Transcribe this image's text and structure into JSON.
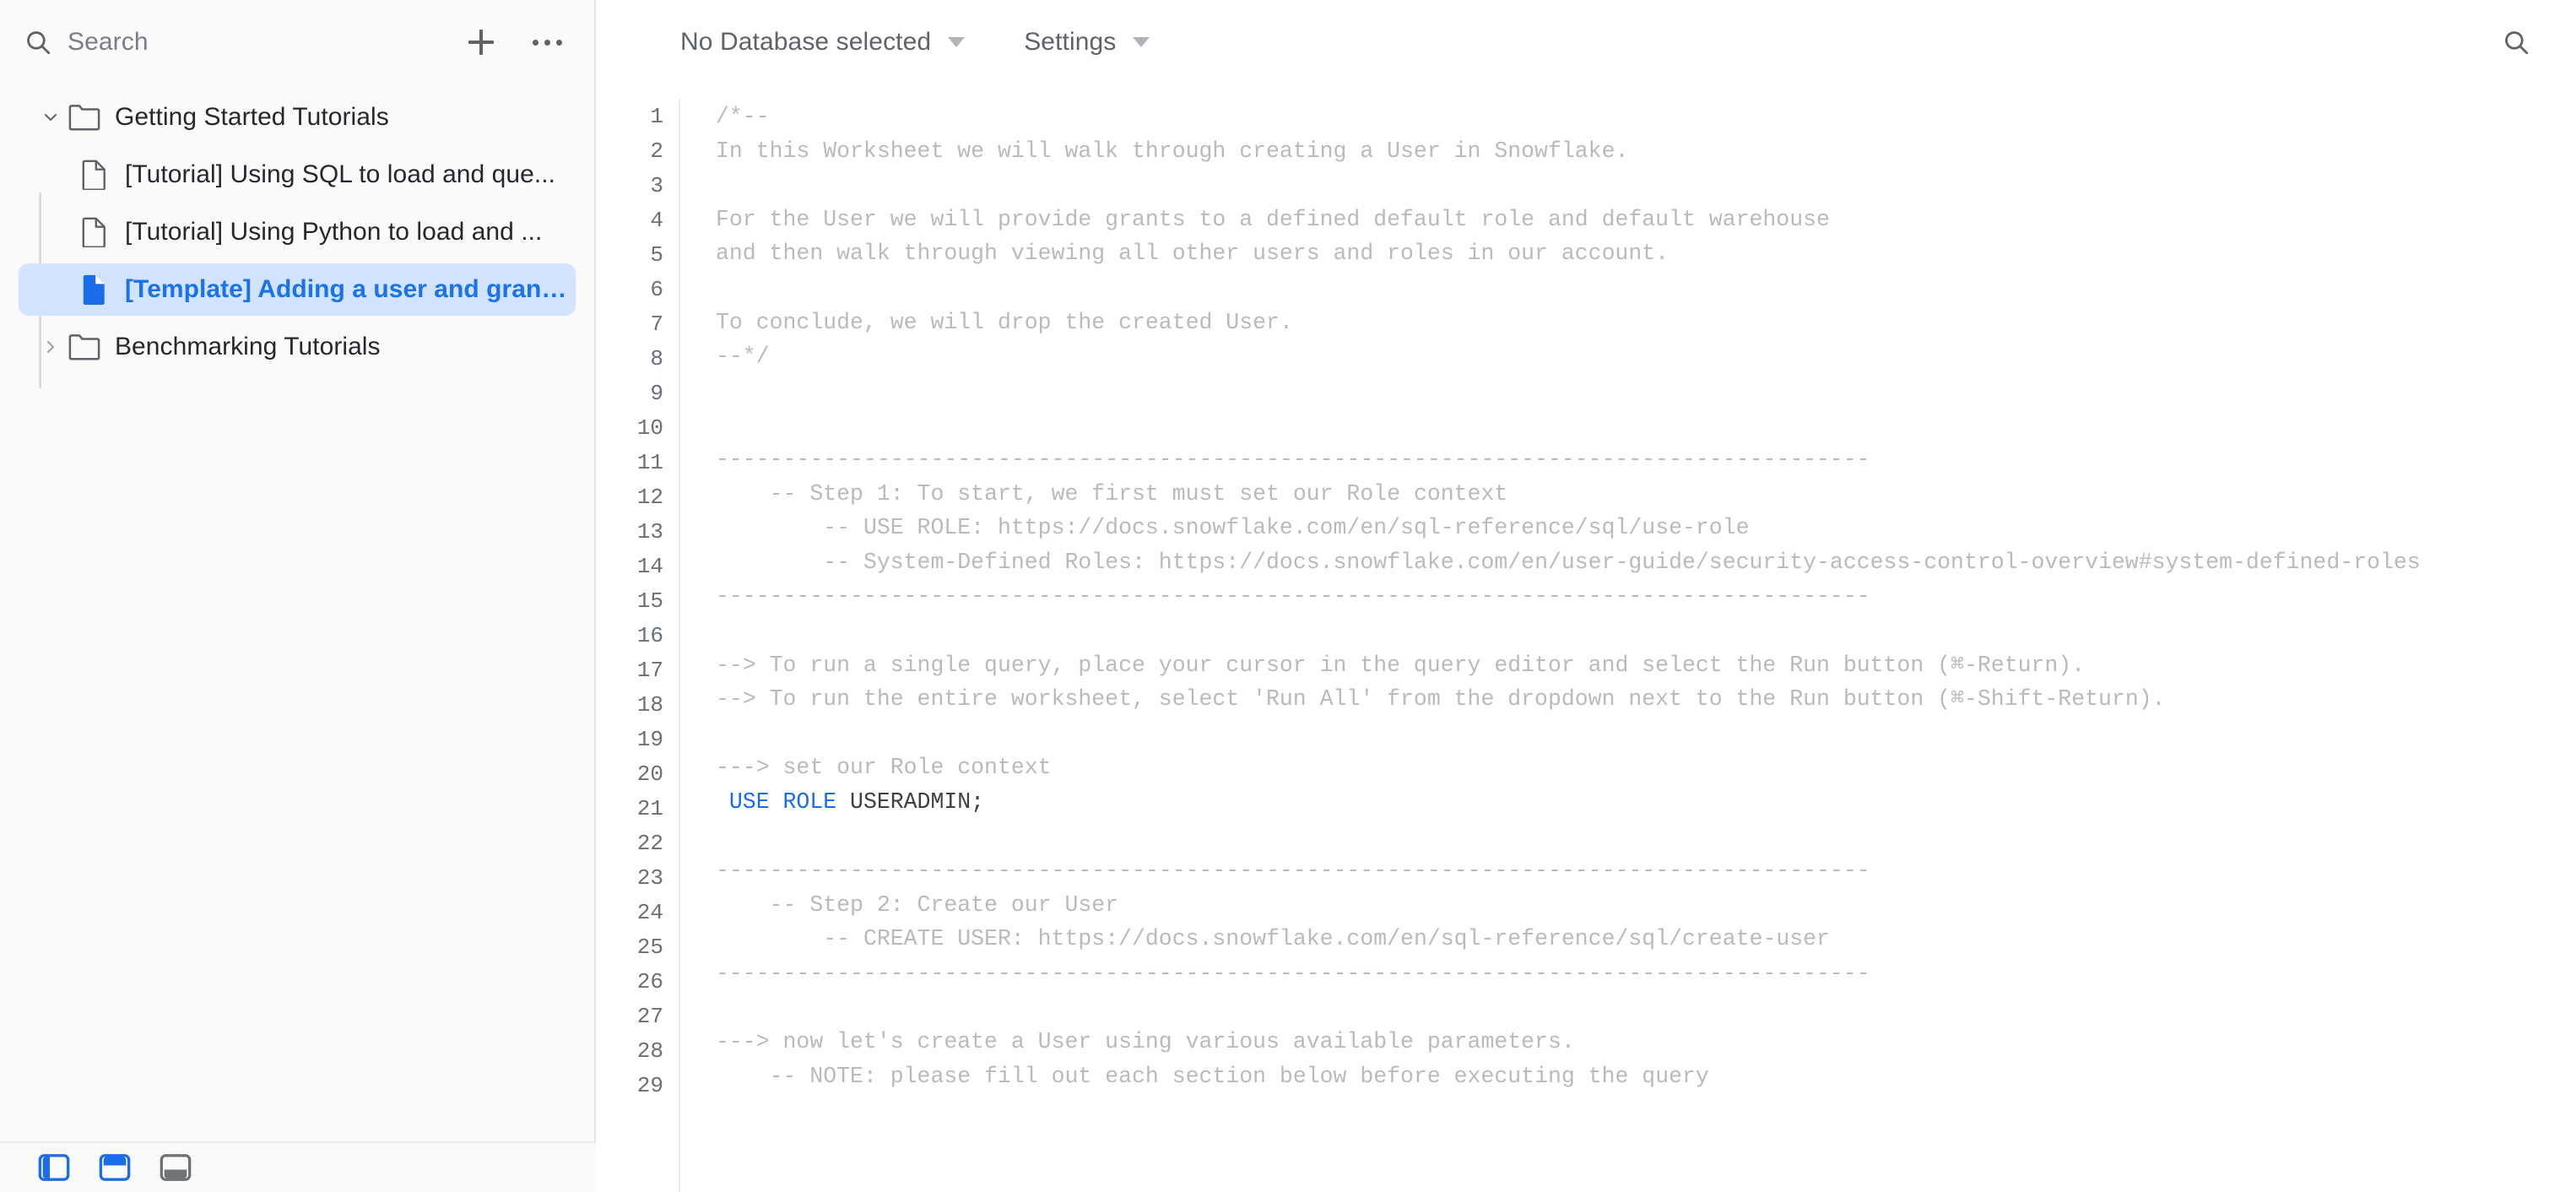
{
  "sidebar": {
    "search": {
      "placeholder": "Search",
      "value": "",
      "icon": "search-icon"
    },
    "add_button": {
      "icon": "plus-icon",
      "label": ""
    },
    "more_button": {
      "icon": "more-horizontal-icon",
      "label": ""
    },
    "tree": [
      {
        "type": "folder",
        "label": "Getting Started Tutorials",
        "expanded": true,
        "chevron": "chevron-down-icon",
        "icon": "folder-icon"
      },
      {
        "type": "file",
        "label": "[Tutorial] Using SQL to load and que...",
        "selected": false,
        "icon": "document-icon"
      },
      {
        "type": "file",
        "label": "[Tutorial] Using Python to load and ...",
        "selected": false,
        "icon": "document-icon"
      },
      {
        "type": "file",
        "label": "[Template] Adding a user and granti...",
        "selected": true,
        "icon": "document-icon"
      },
      {
        "type": "folder",
        "label": "Benchmarking Tutorials",
        "expanded": false,
        "chevron": "chevron-right-icon",
        "icon": "folder-icon"
      }
    ]
  },
  "statusbar": {
    "left_panel_toggle": {
      "icon": "left-panel-icon",
      "active": true
    },
    "top_panel_toggle": {
      "icon": "top-panel-icon",
      "active": true
    },
    "bottom_panel_toggle": {
      "icon": "bottom-panel-icon",
      "active": false
    }
  },
  "toolbar": {
    "database_selector": {
      "label": "No Database selected",
      "icon": "chevron-down-icon"
    },
    "settings": {
      "label": "Settings",
      "icon": "chevron-down-icon"
    },
    "search_button": {
      "icon": "search-icon",
      "label": ""
    }
  },
  "editor": {
    "line_numbers": [
      "1",
      "2",
      "3",
      "4",
      "5",
      "6",
      "7",
      "8",
      "9",
      "10",
      "11",
      "12",
      "13",
      "14",
      "15",
      "16",
      "17",
      "18",
      "19",
      "20",
      "21",
      "22",
      "23",
      "24",
      "25",
      "26",
      "27",
      "28",
      "29"
    ],
    "lines": [
      {
        "n": "1",
        "text": "/*--",
        "style": "comment"
      },
      {
        "n": "2",
        "text": "In this Worksheet we will walk through creating a User in Snowflake.",
        "style": "comment"
      },
      {
        "n": "3",
        "text": "",
        "style": "comment"
      },
      {
        "n": "4",
        "text": "For the User we will provide grants to a defined default role and default warehouse",
        "style": "comment"
      },
      {
        "n": "5",
        "text": "and then walk through viewing all other users and roles in our account.",
        "style": "comment"
      },
      {
        "n": "6",
        "text": "",
        "style": "comment"
      },
      {
        "n": "7",
        "text": "To conclude, we will drop the created User.",
        "style": "comment"
      },
      {
        "n": "8",
        "text": "--*/",
        "style": "comment"
      },
      {
        "n": "9",
        "text": "",
        "style": "comment"
      },
      {
        "n": "10",
        "text": "",
        "style": "comment"
      },
      {
        "n": "11",
        "text": "--------------------------------------------------------------------------------------",
        "style": "comment"
      },
      {
        "n": "12",
        "text": "    -- Step 1: To start, we first must set our Role context",
        "style": "comment"
      },
      {
        "n": "13",
        "text": "        -- USE ROLE: https://docs.snowflake.com/en/sql-reference/sql/use-role",
        "style": "comment"
      },
      {
        "n": "14",
        "text": "        -- System-Defined Roles: https://docs.snowflake.com/en/user-guide/security-access-control-overview#system-defined-roles",
        "style": "comment"
      },
      {
        "n": "15",
        "text": "--------------------------------------------------------------------------------------",
        "style": "comment"
      },
      {
        "n": "16",
        "text": "",
        "style": "comment"
      },
      {
        "n": "17",
        "text": "--> To run a single query, place your cursor in the query editor and select the Run button (⌘-Return).",
        "style": "comment"
      },
      {
        "n": "18",
        "text": "--> To run the entire worksheet, select 'Run All' from the dropdown next to the Run button (⌘-Shift-Return).",
        "style": "comment"
      },
      {
        "n": "19",
        "text": "",
        "style": "comment"
      },
      {
        "n": "20",
        "text": "---> set our Role context",
        "style": "comment"
      },
      {
        "n": "21",
        "text": " USE ROLE USERADMIN;",
        "style": "sql",
        "keyword": "USE ROLE",
        "plain": " USERADMIN;"
      },
      {
        "n": "22",
        "text": "",
        "style": "comment"
      },
      {
        "n": "23",
        "text": "--------------------------------------------------------------------------------------",
        "style": "comment"
      },
      {
        "n": "24",
        "text": "    -- Step 2: Create our User",
        "style": "comment"
      },
      {
        "n": "25",
        "text": "        -- CREATE USER: https://docs.snowflake.com/en/sql-reference/sql/create-user",
        "style": "comment"
      },
      {
        "n": "26",
        "text": "--------------------------------------------------------------------------------------",
        "style": "comment"
      },
      {
        "n": "27",
        "text": "",
        "style": "comment"
      },
      {
        "n": "28",
        "text": "---> now let's create a User using various available parameters.",
        "style": "comment"
      },
      {
        "n": "29",
        "text": "    -- NOTE: please fill out each section below before executing the query",
        "style": "comment"
      }
    ]
  },
  "colors": {
    "accent": "#1a73e8",
    "selection_bg": "#d3e3fd",
    "comment": "#b8babd",
    "keyword": "#1a6dea",
    "sidebar_bg": "#fafafa",
    "editor_bg": "#ffffff"
  }
}
